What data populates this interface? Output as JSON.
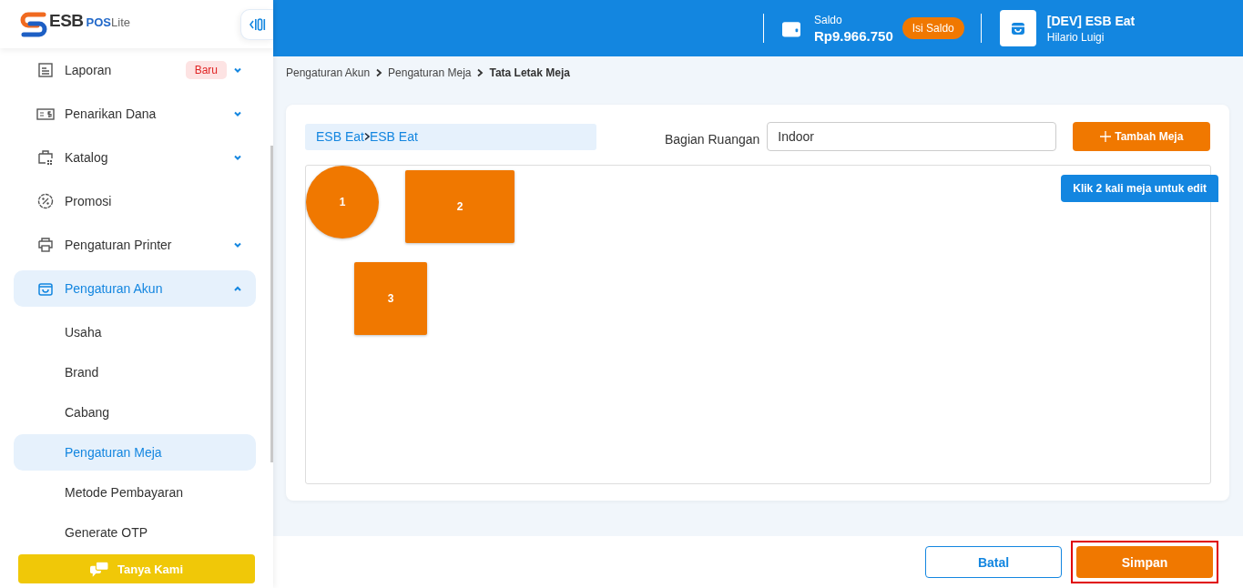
{
  "logo": {
    "brand": "ESB",
    "product_bold": "POS",
    "product_light": "Lite"
  },
  "sidebar": {
    "items": [
      {
        "label": "Laporan",
        "badge": "Baru",
        "expanded": false,
        "selected": false
      },
      {
        "label": "Penarikan Dana",
        "expanded": false,
        "selected": false
      },
      {
        "label": "Katalog",
        "expanded": false,
        "selected": false
      },
      {
        "label": "Promosi",
        "selected": false
      },
      {
        "label": "Pengaturan Printer",
        "expanded": false,
        "selected": false
      },
      {
        "label": "Pengaturan Akun",
        "expanded": true,
        "selected": true,
        "children": [
          {
            "label": "Usaha",
            "selected": false
          },
          {
            "label": "Brand",
            "selected": false
          },
          {
            "label": "Cabang",
            "selected": false
          },
          {
            "label": "Pengaturan Meja",
            "selected": true
          },
          {
            "label": "Metode Pembayaran",
            "selected": false
          },
          {
            "label": "Generate OTP",
            "selected": false
          }
        ]
      }
    ],
    "help_button": "Tanya Kami"
  },
  "header": {
    "balance_label": "Saldo",
    "balance": "Rp9.966.750",
    "topup_button": "Isi Saldo",
    "store_name": "[DEV] ESB Eat",
    "user_name": "Hilario Luigi"
  },
  "breadcrumb": [
    "Pengaturan Akun",
    "Pengaturan Meja",
    "Tata Letak Meja"
  ],
  "layout_card": {
    "location": [
      "ESB Eat",
      "ESB Eat"
    ],
    "room_label": "Bagian Ruangan",
    "room_value": "Indoor",
    "add_button": "Tambah Meja",
    "hint": "Klik 2 kali meja untuk edit",
    "tables": [
      {
        "label": "1",
        "kind": "round"
      },
      {
        "label": "2",
        "kind": "rect"
      },
      {
        "label": "3",
        "kind": "square"
      }
    ]
  },
  "footer": {
    "cancel_button": "Batal",
    "save_button": "Simpan",
    "save_highlighted": true
  }
}
